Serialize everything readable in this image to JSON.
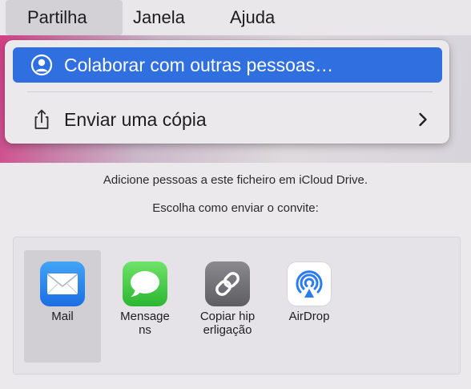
{
  "menubar": {
    "items": [
      {
        "label": "Partilha",
        "active": true
      },
      {
        "label": "Janela"
      },
      {
        "label": "Ajuda"
      }
    ]
  },
  "dropdown": {
    "items": [
      {
        "label": "Colaborar com outras pessoas…",
        "icon": "person-circle-icon",
        "highlighted": true
      },
      {
        "label": "Enviar uma cópia",
        "icon": "share-icon",
        "submenu": true
      }
    ]
  },
  "panel": {
    "description": "Adicione pessoas a este ficheiro em iCloud Drive.",
    "prompt": "Escolha como enviar o convite:",
    "share_options": [
      {
        "label": "Mail",
        "icon": "mail-icon",
        "selected": true
      },
      {
        "label": "Mensagens",
        "icon": "messages-icon"
      },
      {
        "label": "Copiar hiperligação",
        "icon": "link-icon"
      },
      {
        "label": "AirDrop",
        "icon": "airdrop-icon"
      }
    ]
  },
  "colors": {
    "highlight": "#2f6fe0",
    "menubar_bg": "#e9e7ea",
    "selected_bg": "#d1cfd4"
  }
}
